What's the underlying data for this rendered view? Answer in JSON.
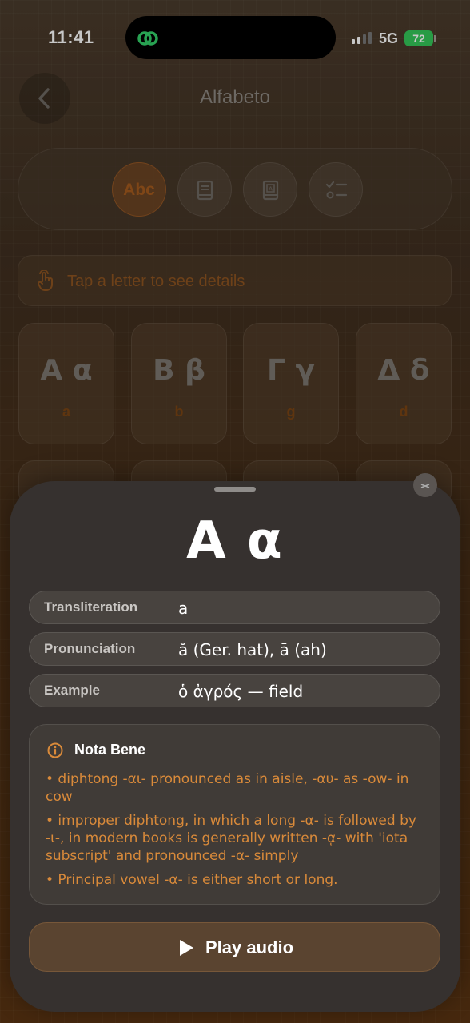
{
  "status_bar": {
    "time": "11:41",
    "network": "5G",
    "battery": "72"
  },
  "header": {
    "title": "Alfabeto",
    "back_icon": "chevron-left-icon"
  },
  "mode_switcher": {
    "items": [
      {
        "label": "Abc",
        "icon": "abc-text-icon",
        "active": true
      },
      {
        "label": "",
        "icon": "book-icon",
        "active": false
      },
      {
        "label": "",
        "icon": "dictionary-icon",
        "active": false
      },
      {
        "label": "",
        "icon": "checklist-icon",
        "active": false
      }
    ]
  },
  "hint": {
    "icon": "tap-hand-icon",
    "text": "Tap a letter to see details"
  },
  "letters": [
    {
      "glyph": "Α α",
      "translit": "a"
    },
    {
      "glyph": "Β β",
      "translit": "b"
    },
    {
      "glyph": "Γ γ",
      "translit": "g"
    },
    {
      "glyph": "Δ δ",
      "translit": "d"
    }
  ],
  "sheet": {
    "letter": "Α α",
    "rows": [
      {
        "label": "Transliteration",
        "value": "a"
      },
      {
        "label": "Pronunciation",
        "value": "ă (Ger. hat), ā (ah)"
      },
      {
        "label": "Example",
        "value": "ὁ ἀγρός — field"
      }
    ],
    "nota_bene": {
      "title": "Nota Bene",
      "items": [
        "• diphtong -αι- pronounced as in aisle, -αυ- as -ow- in cow",
        "• improper diphtong, in which a long -α- is followed by -ι-, in modern books is generally written -ᾳ- with 'iota subscript' and pronounced -α- simply",
        "• Principal vowel -α- is either short or long."
      ]
    },
    "play_button": "Play audio"
  },
  "colors": {
    "accent": "#d98a3a",
    "sheet_bg": "#36312f",
    "battery": "#34c759"
  }
}
